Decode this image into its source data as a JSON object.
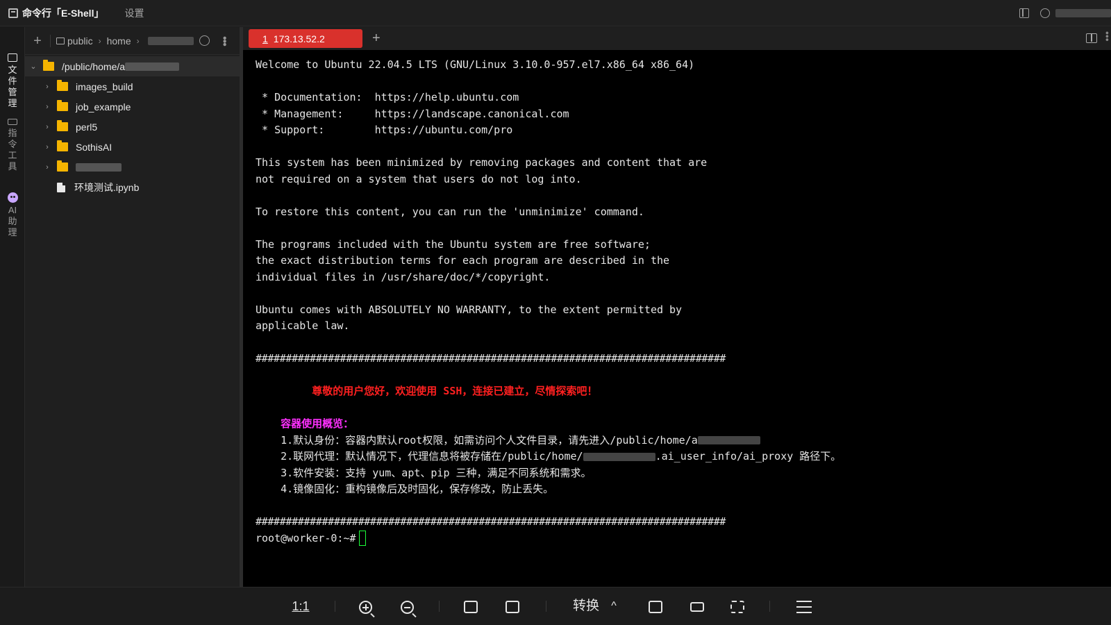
{
  "titlebar": {
    "app_title": "命令行「E-Shell」",
    "settings_label": "设置"
  },
  "sidebar_tabs": [
    {
      "label_chars": [
        "文",
        "件",
        "管",
        "理"
      ]
    },
    {
      "label_chars": [
        "指",
        "令",
        "工",
        "具"
      ]
    },
    {
      "label_chars": [
        "AI",
        "助",
        "理"
      ]
    }
  ],
  "path": {
    "seg1": "public",
    "seg2": "home",
    "chevron": "›"
  },
  "tree": {
    "root": "/public/home/a",
    "items": [
      "images_build",
      "job_example",
      "perl5",
      "SothisAI"
    ],
    "file": "环境测试.ipynb"
  },
  "tab": {
    "index": "1",
    "host": "173.13.52.2"
  },
  "terminal": {
    "lines": [
      "Welcome to Ubuntu 22.04.5 LTS (GNU/Linux 3.10.0-957.el7.x86_64 x86_64)",
      "",
      " * Documentation:  https://help.ubuntu.com",
      " * Management:     https://landscape.canonical.com",
      " * Support:        https://ubuntu.com/pro",
      "",
      "This system has been minimized by removing packages and content that are",
      "not required on a system that users do not log into.",
      "",
      "To restore this content, you can run the 'unminimize' command.",
      "",
      "The programs included with the Ubuntu system are free software;",
      "the exact distribution terms for each program are described in the",
      "individual files in /usr/share/doc/*/copyright.",
      "",
      "Ubuntu comes with ABSOLUTELY NO WARRANTY, to the extent permitted by",
      "applicable law.",
      ""
    ],
    "hash_line": "##############################################################################",
    "greeting": "         尊敬的用户您好，欢迎使用 SSH，连接已建立，尽情探索吧！",
    "overview_title": "    容器使用概览：",
    "notes": [
      "    1.默认身份：容器内默认root权限，如需访问个人文件目录，请先进入/public/home/a",
      "    2.联网代理：默认情况下，代理信息将被存储在/public/home/",
      ".ai_user_info/ai_proxy 路径下。",
      "    3.软件安装：支持 yum、apt、pip 三种，满足不同系统和需求。",
      "    4.镜像固化：重构镜像后及时固化，保存修改，防止丢失。"
    ],
    "prompt": "root@worker-0:~#"
  },
  "bottombar": {
    "ratio_label": "1:1",
    "convert_label": "转换",
    "caret": "^"
  }
}
